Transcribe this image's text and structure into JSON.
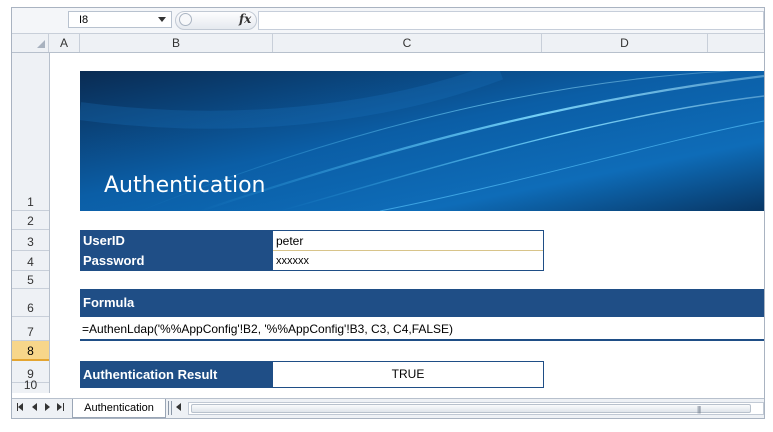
{
  "formula_bar": {
    "name_box": "I8",
    "fx_label": "fx",
    "formula": ""
  },
  "columns": [
    "A",
    "B",
    "C",
    "D"
  ],
  "rows": [
    "1",
    "2",
    "3",
    "4",
    "5",
    "6",
    "7",
    "8",
    "9",
    "10"
  ],
  "active_row": "8",
  "banner": {
    "title": "Authentication"
  },
  "credentials": {
    "userid_label": "UserID",
    "userid_value": "peter",
    "password_label": "Password",
    "password_value": "xxxxxx"
  },
  "formula_section": {
    "header": "Formula",
    "text": "=AuthenLdap('%%AppConfig'!B2, '%%AppConfig'!B3, C3, C4,FALSE)"
  },
  "result": {
    "label": "Authentication Result",
    "value": "TRUE"
  },
  "sheet_tabs": [
    {
      "label": "Authentication",
      "active": true
    }
  ],
  "colors": {
    "header_blue": "#1f4e86",
    "active_row": "#f7d68a"
  }
}
